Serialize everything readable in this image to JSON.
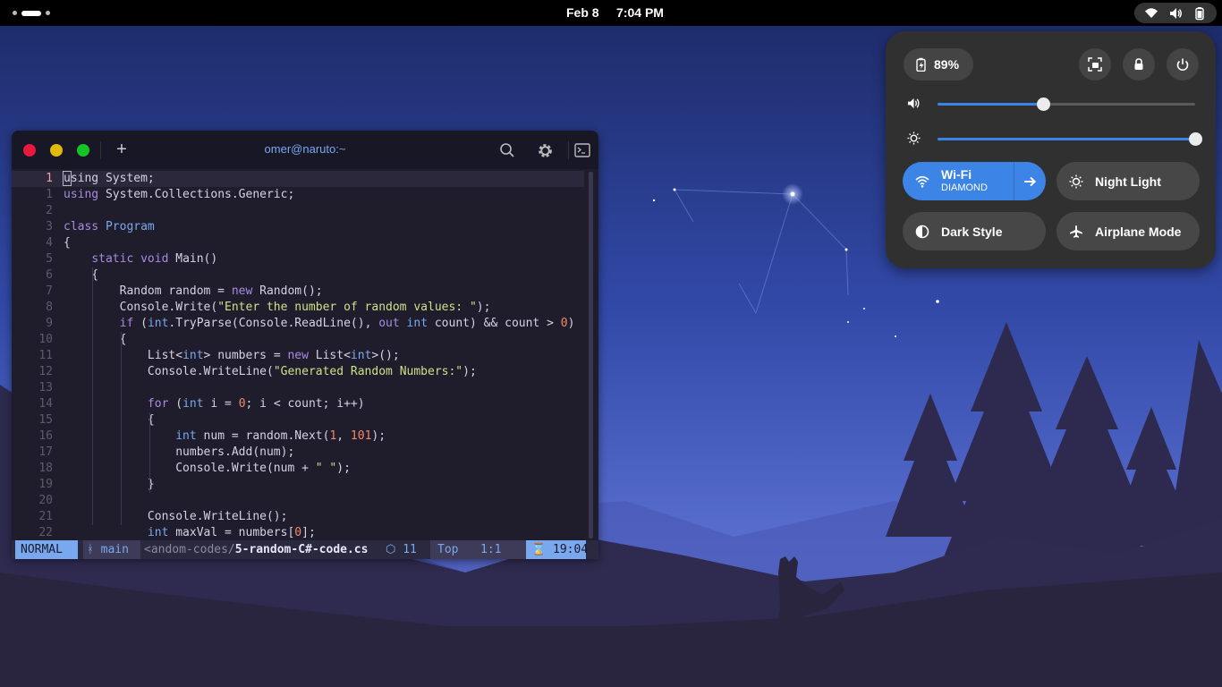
{
  "topbar": {
    "date": "Feb 8",
    "time": "7:04 PM",
    "status_icons": [
      "wifi-icon",
      "volume-icon",
      "battery-icon"
    ]
  },
  "terminal": {
    "title": "omer@naruto:~",
    "code_lines": [
      {
        "num": "1",
        "text": "using System;"
      },
      {
        "num": "1",
        "text": "using System.Collections.Generic;"
      },
      {
        "num": "2",
        "text": ""
      },
      {
        "num": "3",
        "text": "class Program"
      },
      {
        "num": "4",
        "text": "{"
      },
      {
        "num": "5",
        "text": "    static void Main()"
      },
      {
        "num": "6",
        "text": "    {"
      },
      {
        "num": "7",
        "text": "        Random random = new Random();"
      },
      {
        "num": "8",
        "text": "        Console.Write(\"Enter the number of random values: \");"
      },
      {
        "num": "9",
        "text": "        if (int.TryParse(Console.ReadLine(), out int count) && count > 0)"
      },
      {
        "num": "10",
        "text": "        {"
      },
      {
        "num": "11",
        "text": "            List<int> numbers = new List<int>();"
      },
      {
        "num": "12",
        "text": "            Console.WriteLine(\"Generated Random Numbers:\");"
      },
      {
        "num": "13",
        "text": ""
      },
      {
        "num": "14",
        "text": "            for (int i = 0; i < count; i++)"
      },
      {
        "num": "15",
        "text": "            {"
      },
      {
        "num": "16",
        "text": "                int num = random.Next(1, 101);"
      },
      {
        "num": "17",
        "text": "                numbers.Add(num);"
      },
      {
        "num": "18",
        "text": "                Console.Write(num + \" \");"
      },
      {
        "num": "19",
        "text": "            }"
      },
      {
        "num": "20",
        "text": ""
      },
      {
        "num": "21",
        "text": "            Console.WriteLine();"
      },
      {
        "num": "22",
        "text": "            int maxVal = numbers[0];"
      }
    ],
    "statusline": {
      "mode": "NORMAL",
      "branch": "main",
      "path_prefix": "<andom-codes/",
      "filename": "5-random-C#-code.cs",
      "diagnostics": "11",
      "position_percent": "Top",
      "line_col": "1:1",
      "clock": "19:04"
    }
  },
  "quick_settings": {
    "battery_label": "89%",
    "volume_level": 0.41,
    "brightness_level": 1.0,
    "wifi": {
      "label": "Wi-Fi",
      "network": "DIAMOND",
      "active": true
    },
    "night_light": {
      "label": "Night Light",
      "active": false
    },
    "dark_style": {
      "label": "Dark Style",
      "active": false
    },
    "airplane_mode": {
      "label": "Airplane Mode",
      "active": false
    }
  },
  "colors": {
    "accent": "#3c84e6",
    "terminal_bg": "#1f1d2b",
    "panel_bg": "#303030"
  }
}
